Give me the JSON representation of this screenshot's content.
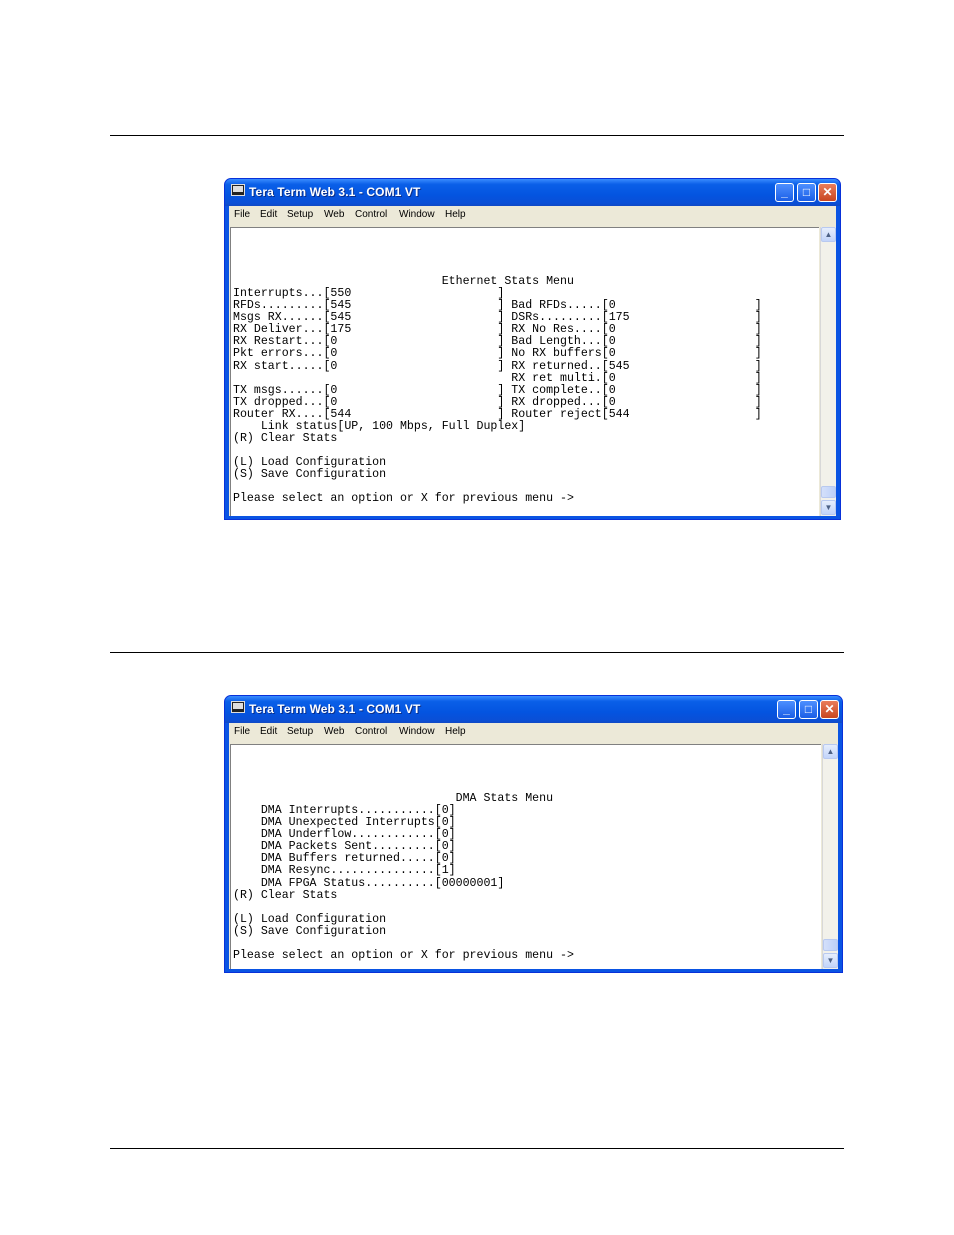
{
  "window1": {
    "title": "Tera Term Web 3.1 - COM1 VT",
    "menu": [
      "File",
      "Edit",
      "Setup",
      "Web",
      "Control",
      "Window",
      "Help"
    ],
    "minimize": "_",
    "maximize": "□",
    "close": "✕",
    "scroll_up": "▲",
    "scroll_down": "▼",
    "terminal_lines": [
      "",
      "",
      "",
      "",
      "                              Ethernet Stats Menu",
      "Interrupts...[550                     ]",
      "RFDs.........[545                     ] Bad RFDs.....[0                    ]",
      "Msgs RX......[545                     ] DSRs.........[175                  ]",
      "RX Deliver...[175                     ] RX No Res....[0                    ]",
      "RX Restart...[0                       ] Bad Length...[0                    ]",
      "Pkt errors...[0                       ] No RX buffers[0                    ]",
      "RX start.....[0                       ] RX returned..[545                  ]",
      "                                        RX ret multi.[0                    ]",
      "TX msgs......[0                       ] TX complete..[0                    ]",
      "TX dropped...[0                       ] RX dropped...[0                    ]",
      "Router RX....[544                     ] Router reject[544                  ]",
      "    Link status[UP, 100 Mbps, Full Duplex]",
      "(R) Clear Stats",
      "",
      "(L) Load Configuration",
      "(S) Save Configuration",
      "",
      "Please select an option or X for previous menu ->"
    ]
  },
  "window2": {
    "title": "Tera Term Web 3.1 - COM1 VT",
    "menu": [
      "File",
      "Edit",
      "Setup",
      "Web",
      "Control",
      "Window",
      "Help"
    ],
    "minimize": "_",
    "maximize": "□",
    "close": "✕",
    "scroll_up": "▲",
    "scroll_down": "▼",
    "terminal_lines": [
      "",
      "",
      "",
      "",
      "                                DMA Stats Menu",
      "    DMA Interrupts...........[0]",
      "    DMA Unexpected Interrupts[0]",
      "    DMA Underflow............[0]",
      "    DMA Packets Sent.........[0]",
      "    DMA Buffers returned.....[0]",
      "    DMA Resync...............[1]",
      "    DMA FPGA Status..........[00000001]",
      "(R) Clear Stats",
      "",
      "(L) Load Configuration",
      "(S) Save Configuration",
      "",
      "Please select an option or X for previous menu ->"
    ]
  }
}
